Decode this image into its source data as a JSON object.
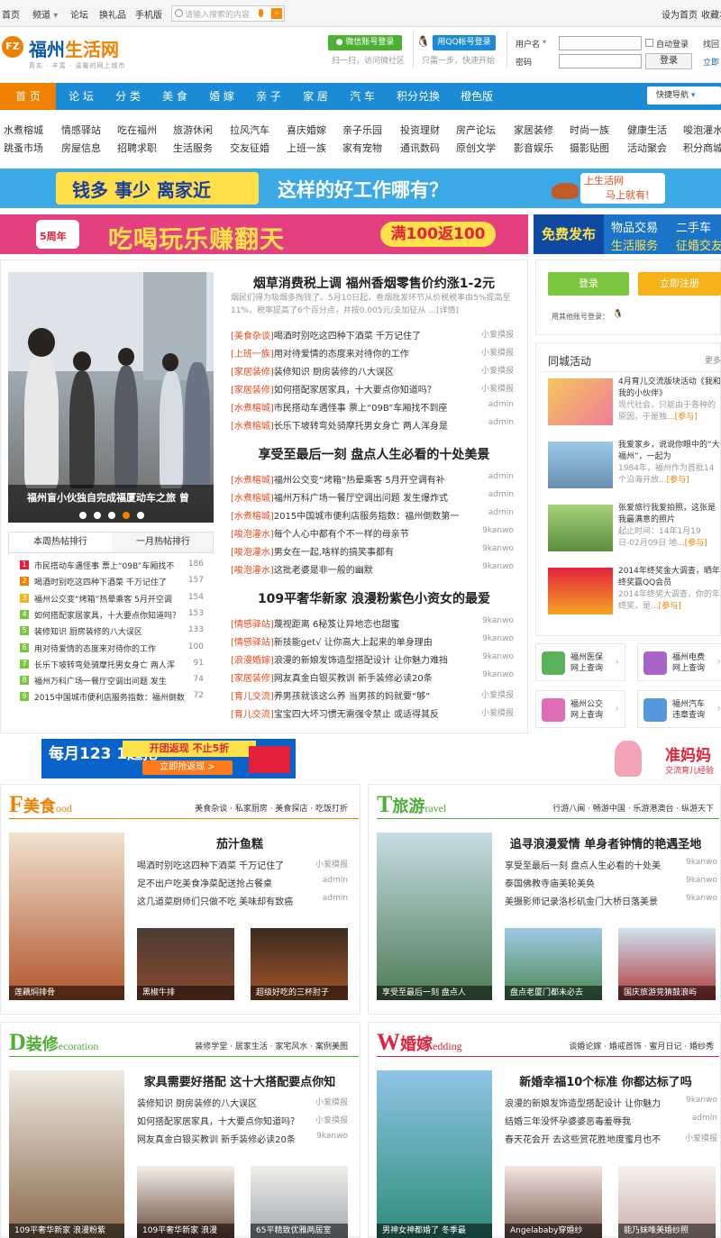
{
  "topbar": {
    "home": "首页",
    "channel": "频道",
    "forum": "论坛",
    "points_gift": "换礼品",
    "mobile": "手机版",
    "search_placeholder": "请输入搜索的内容",
    "set_home": "设为首页",
    "favorite": "收藏本"
  },
  "header": {
    "logo_badge": "FZ",
    "site_name_a": "福州",
    "site_name_b": "生活网",
    "slogan": "真实 · 丰富 · 温暖的网上城市",
    "wechat_login": "微信账号登录",
    "wechat_sub": "扫一扫，访问微社区",
    "qq_login": "用QQ帐号登录",
    "qq_sub": "只需一步，快速开始",
    "username_label": "用户名",
    "password_label": "密码",
    "auto_login": "自动登录",
    "login_button": "登录",
    "forgot": "找回",
    "register": "立即"
  },
  "nav": {
    "items": [
      "首 页",
      "论 坛",
      "分 类",
      "美 食",
      "婚 嫁",
      "亲 子",
      "家 居",
      "汽 车",
      "积分兑换",
      "橙色版"
    ],
    "quick": "快捷导航"
  },
  "sublinks": {
    "row1": [
      "水煮榕城",
      "情感驿站",
      "吃在福州",
      "旅游休闲",
      "拉风汽车",
      "喜庆婚嫁",
      "亲子乐园",
      "投资理财",
      "房产论坛",
      "家居装修",
      "时尚一族",
      "健康生活",
      "唆泡灌水"
    ],
    "row2": [
      "跳蚤市场",
      "房屋信息",
      "招聘求职",
      "生活服务",
      "交友征婚",
      "上班一族",
      "家有宠物",
      "通讯数码",
      "原创文学",
      "影音娱乐",
      "摄影贴图",
      "活动聚会",
      "积分商城"
    ]
  },
  "banners": {
    "b1_left": "钱多 事少 离家近",
    "b1_mid": "这样的好工作哪有？",
    "b1_r1": "上生活网",
    "b1_r2": "马上就有!",
    "b2_anniv": "5周年",
    "b2_main": "吃喝玩乐赚翻天",
    "b2_badge": "满100返100",
    "b3_left": "免费发布",
    "b3_a": "物品交易",
    "b3_b": "二手车",
    "b3_c": "生活服务",
    "b3_d": "征婚交友",
    "b4_main": "每月123 1起抢",
    "b4_sub": "开团返现 不止5折",
    "b4_btn": "立即抢返现 >",
    "b5_main": "准妈妈",
    "b5_sub": "交流育儿经验"
  },
  "slideshow": {
    "caption": "福州盲小伙独自完成福厦动车之旅 曾"
  },
  "hot": {
    "tabs": [
      "本周热帖排行",
      "一月热帖排行"
    ],
    "items": [
      {
        "title": "市民搭动车遇怪事 票上“09B”车厢找不",
        "count": "186"
      },
      {
        "title": "喝酒时别吃这四种下酒菜 千万记住了",
        "count": "157"
      },
      {
        "title": "福州公交变“烤箱”热晕乘客 5月开空调",
        "count": "154"
      },
      {
        "title": "如何搭配家居家具，十大要点你知道吗？",
        "count": "153"
      },
      {
        "title": "装修知识 厨房装修的八大误区",
        "count": "133"
      },
      {
        "title": "用对待爱情的态度来对待你的工作",
        "count": "100"
      },
      {
        "title": "长乐下坡转弯处骑摩托男女身亡 两人浑",
        "count": "91"
      },
      {
        "title": "福州万科广场一餐厅空调出问题 发生",
        "count": "74"
      },
      {
        "title": "2015中国城市便利店服务指数：福州倒数",
        "count": "72"
      }
    ]
  },
  "center": {
    "headline1": "烟草消费税上调 福州香烟零售价约涨1-2元",
    "summary1": "烟民们得为吸烟多掏钱了。5月10日起，卷烟批发环节从价税税率由5%提高至11%，税率提高了6个百分点，并按0.005元/支加征从 ...[详情]",
    "list1": [
      {
        "tag": "[美食杂谈]",
        "title": "喝酒时别吃这四种下酒菜 千万记住了",
        "author": "小爱摸报"
      },
      {
        "tag": "[上班一族]",
        "title": "用对待爱情的态度来对待你的工作",
        "author": "小爱摸报"
      },
      {
        "tag": "[家居装修]",
        "title": "装修知识 厨房装修的八大误区",
        "author": "小爱摸报"
      },
      {
        "tag": "[家居装修]",
        "title": "如何搭配家居家具，十大要点你知道吗？",
        "author": "小爱摸报"
      },
      {
        "tag": "[水煮榕城]",
        "title": "市民搭动车遇怪事 票上“09B”车厢找不到座",
        "author": "admin"
      },
      {
        "tag": "[水煮榕城]",
        "title": "长乐下坡转弯处骑摩托男女身亡 两人浑身是",
        "author": "admin"
      }
    ],
    "headline2": "享受至最后一刻 盘点人生必看的十处美景",
    "list2": [
      {
        "tag": "[水煮榕城]",
        "title": "福州公交变“烤箱”热晕乘客 5月开空调有补",
        "author": "admin"
      },
      {
        "tag": "[水煮榕城]",
        "title": "福州万科广场一餐厅空调出问题 发生爆炸式",
        "author": "admin"
      },
      {
        "tag": "[水煮榕城]",
        "title": "2015中国城市便利店服务指数：福州倒数第一",
        "author": "admin"
      },
      {
        "tag": "[唆泡灌水]",
        "title": "每个人心中都有个不一样的母亲节",
        "author": "9kanwo"
      },
      {
        "tag": "[唆泡灌水]",
        "title": "男女在一起,啥样的搞笑事都有",
        "author": "9kanwo"
      },
      {
        "tag": "[唆泡灌水]",
        "title": "这批老婆是非一般的幽默",
        "author": "9kanwo"
      }
    ],
    "headline3": "109平奢华新家 浪漫粉紫色小资女的最爱",
    "list3": [
      {
        "tag": "[情感驿站]",
        "title": "蔑视距离 6秘笈让异地恋也甜蜜",
        "author": "9kanwo"
      },
      {
        "tag": "[情感驿站]",
        "title": "新技能get√ 让你高大上起来的单身理由",
        "author": "9kanwo"
      },
      {
        "tag": "[浪漫婚嫁]",
        "title": "浪漫的新娘发饰造型搭配设计 让你魅力难挡",
        "author": "9kanwo"
      },
      {
        "tag": "[家居装修]",
        "title": "网友真金白银买教训 新手装修必读20条",
        "author": "9kanwo"
      },
      {
        "tag": "[育儿交流]",
        "title": "养男孩就该这么养 当男孩的妈就要“够”",
        "author": "小爱摸报"
      },
      {
        "tag": "[育儿交流]",
        "title": "宝宝四大坏习惯无需强令禁止 或适得其反",
        "author": "小爱摸报"
      }
    ]
  },
  "right": {
    "login": "登录",
    "register": "立即注册",
    "other_login": "用其他账号登录：",
    "events_title": "同城活动",
    "more": "更多",
    "events": [
      {
        "title": "4月育儿交流版块活动《我和我的小伙伴》",
        "desc": "现代社会，只能由于各种的原因，于是独",
        "more": "...[参与]"
      },
      {
        "title": "我爱家乡，说说你眼中的“大福州”，一起为",
        "desc": "1984年，福州作为首批14个沿海开放",
        "more": "...[参与]"
      },
      {
        "title": "张爱旅行我爱拍照，这张是我最满意的照片",
        "desc": "起止时间：14年1月19日-02月09日 地",
        "more": "...[参与]"
      },
      {
        "title": "2014年终奖金大调查，晒年终奖赢QQ会员",
        "desc": "2014年终奖大调查，你的年终奖，是",
        "more": "...[参与]"
      }
    ],
    "services": [
      {
        "l1": "福州医保",
        "l2": "网上查询"
      },
      {
        "l1": "福州电费",
        "l2": "网上查询"
      },
      {
        "l1": "福州公交",
        "l2": "网上查询"
      },
      {
        "l1": "福州汽车",
        "l2": "违章查询"
      }
    ]
  },
  "sections": {
    "food": {
      "initial": "F",
      "cn": "美食",
      "en": "ood",
      "links": "美食杂谈 · 私家厨房 · 美食探店 · 吃饭打折",
      "headline": "茄汁鱼糕",
      "list": [
        {
          "title": "喝酒时别吃这四种下酒菜 千万记住了",
          "author": "小爱摸报"
        },
        {
          "title": "足不出户吃美食净菜配送抢占餐桌",
          "author": "admin"
        },
        {
          "title": "这几道菜厨师们只做不吃 美味却有致癌",
          "author": "admin"
        }
      ],
      "pics": [
        "莲藕焖排骨",
        "黑椒牛排",
        "超级好吃的三杯肘子"
      ]
    },
    "travel": {
      "initial": "T",
      "cn": "旅游",
      "en": "ravel",
      "links": "行游八闽 · 畅游中国 · 乐游港澳台 · 纵游天下",
      "headline": "追寻浪漫爱情 单身者钟情的艳遇圣地",
      "list": [
        {
          "title": "享受至最后一刻 盘点人生必看的十处美",
          "author": "9kanwo"
        },
        {
          "title": "泰国佛教寺庙美轮美奂",
          "author": "9kanwo"
        },
        {
          "title": "美摄影师记录洛杉矶金门大桥日落美景",
          "author": "9kanwo"
        }
      ],
      "pics": [
        "享受至最后一刻 盘点人",
        "盘点老厦门都未必去",
        "国庆旅游竞猜鼓浪屿"
      ]
    },
    "deco": {
      "initial": "D",
      "cn": "装修",
      "en": "ecoration",
      "links": "装修学堂 · 居家生活 · 家宅风水 · 案例美图",
      "headline": "家具需要好搭配 这十大搭配要点你知",
      "list": [
        {
          "title": "装修知识 厨房装修的八大误区",
          "author": "小爱摸报"
        },
        {
          "title": "如何搭配家居家具，十大要点你知道吗？",
          "author": "小爱摸报"
        },
        {
          "title": "网友真金白银买教训 新手装修必读20条",
          "author": "9kanwo"
        }
      ],
      "pics": [
        "109平奢华新家 浪漫粉紫",
        "109平奢华新家 浪漫",
        "65平精致优雅两居室"
      ]
    },
    "wedding": {
      "initial": "W",
      "cn": "婚嫁",
      "en": "edding",
      "links": "谈婚论嫁 · 婚戒首饰 · 蜜月日记 · 婚纱秀",
      "headline": "新婚幸福10个标准 你都达标了吗",
      "list": [
        {
          "title": "浪漫的新娘发饰造型搭配设计 让你魅力",
          "author": "9kanwo"
        },
        {
          "title": "结婚三年没怀孕婆婆恶毒羞辱我",
          "author": "admin"
        },
        {
          "title": "春天花会开 去这些赏花胜地度蜜月也不",
          "author": "小爱摸报"
        }
      ],
      "pics": [
        "男神女神都婚了 冬季最",
        "Angelababy穿婚纱",
        "能乃妹唯美婚纱照"
      ]
    }
  }
}
